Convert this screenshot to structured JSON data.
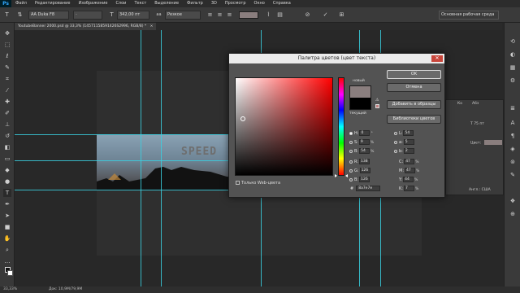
{
  "app": {
    "logo": "Ps"
  },
  "menu": [
    "Файл",
    "Редактирование",
    "Изображение",
    "Слои",
    "Текст",
    "Выделение",
    "Фильтр",
    "3D",
    "Просмотр",
    "Окно",
    "Справка"
  ],
  "options_bar": {
    "font_family": "AA Duka F8",
    "font_size": "342,00 пт",
    "antialias": "Резкое",
    "workspace": "Основная рабочая среда"
  },
  "document_tab": {
    "title": "YoutubeBanner 2000.psd @ 33,3% (14571158591426S2996, RGB/8) *"
  },
  "canvas": {
    "banner_text": "SPEED"
  },
  "status": {
    "zoom": "33,33%",
    "doc_info": "Док: 10,9M/79,9M"
  },
  "char_panel": {
    "tabs": [
      "Ко",
      "Абз"
    ],
    "size": "75 пт",
    "color_label": "Цвет:",
    "lang": "Англ.: США"
  },
  "dialog": {
    "title": "Палитра цветов (цвет текста)",
    "close": "✕",
    "new_label": "новый",
    "current_label": "текущий",
    "buttons": {
      "ok": "OK",
      "cancel": "Отмена",
      "add_to_swatches": "Добавить в образцы",
      "color_libraries": "Библиотеки цветов"
    },
    "web_only": "Только Web-цвета",
    "hex_symbol": "#",
    "hex_value": "8a7e7e",
    "fields_left": [
      {
        "label": "H:",
        "value": "0",
        "unit": "°",
        "selected": true
      },
      {
        "label": "S:",
        "value": "9",
        "unit": "%",
        "selected": false
      },
      {
        "label": "B:",
        "value": "54",
        "unit": "%",
        "selected": false
      },
      {
        "label": "R:",
        "value": "138",
        "unit": "",
        "selected": false
      },
      {
        "label": "G:",
        "value": "126",
        "unit": "",
        "selected": false
      },
      {
        "label": "B:",
        "value": "126",
        "unit": "",
        "selected": false
      }
    ],
    "fields_right": [
      {
        "label": "L:",
        "value": "54",
        "unit": ""
      },
      {
        "label": "a:",
        "value": "5",
        "unit": ""
      },
      {
        "label": "b:",
        "value": "2",
        "unit": ""
      },
      {
        "label": "C:",
        "value": "47",
        "unit": "%"
      },
      {
        "label": "M:",
        "value": "47",
        "unit": "%"
      },
      {
        "label": "Y:",
        "value": "44",
        "unit": "%"
      },
      {
        "label": "K:",
        "value": "7",
        "unit": "%"
      }
    ],
    "colors": {
      "new": "#8a7e7e",
      "current": "#000000"
    }
  }
}
